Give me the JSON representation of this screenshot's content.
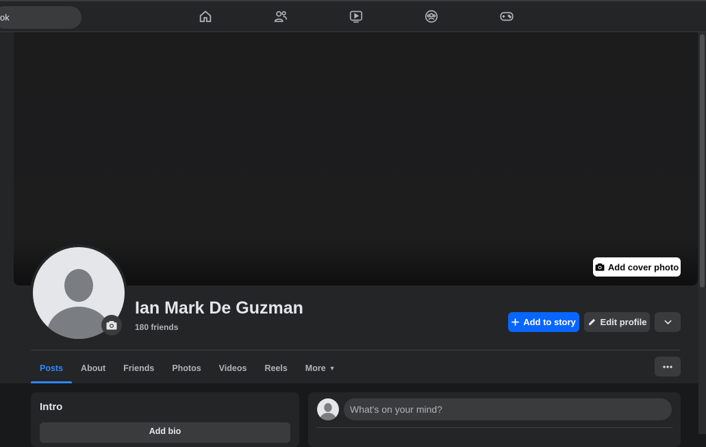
{
  "search": {
    "value": "ok"
  },
  "nav": [
    {
      "icon": "home-icon"
    },
    {
      "icon": "friends-icon"
    },
    {
      "icon": "watch-icon"
    },
    {
      "icon": "groups-icon"
    },
    {
      "icon": "gaming-icon"
    }
  ],
  "cover": {
    "add_cover_label": "Add cover photo"
  },
  "profile": {
    "name": "Ian Mark De Guzman",
    "friends": "180 friends"
  },
  "actions": {
    "add_story": "Add to story",
    "edit_profile": "Edit profile"
  },
  "tabs": [
    {
      "label": "Posts",
      "active": true
    },
    {
      "label": "About"
    },
    {
      "label": "Friends"
    },
    {
      "label": "Photos"
    },
    {
      "label": "Videos"
    },
    {
      "label": "Reels"
    },
    {
      "label": "More"
    }
  ],
  "intro": {
    "title": "Intro",
    "add_bio": "Add bio"
  },
  "composer": {
    "placeholder": "What's on your mind?"
  },
  "colors": {
    "accent": "#0866ff",
    "active_tab": "#2d88ff",
    "surface": "#242526",
    "background": "#18191a"
  }
}
